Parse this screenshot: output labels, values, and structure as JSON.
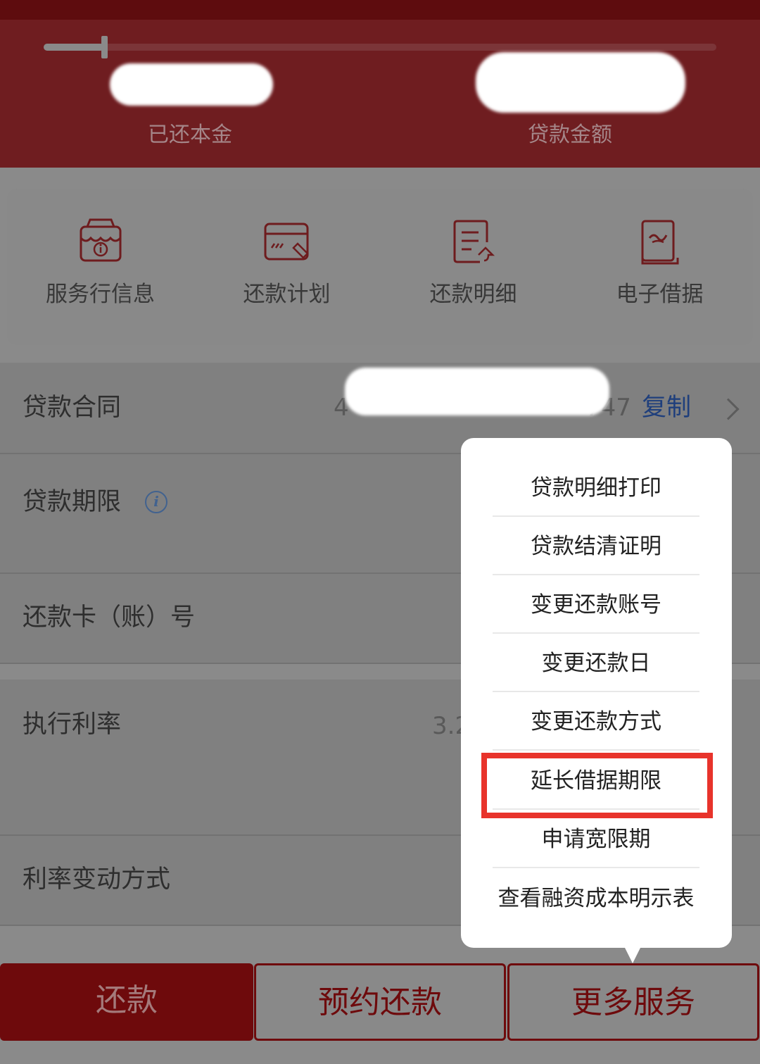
{
  "header": {
    "repaid_principal_label": "已还本金",
    "loan_amount_label": "贷款金额",
    "repaid_progress": 0.09
  },
  "quick_services": [
    {
      "label": "服务行信息",
      "icon": "bank-info-icon"
    },
    {
      "label": "还款计划",
      "icon": "repayment-plan-icon"
    },
    {
      "label": "还款明细",
      "icon": "repayment-detail-icon"
    },
    {
      "label": "电子借据",
      "icon": "e-receipt-icon"
    }
  ],
  "rows": {
    "contract": {
      "label": "贷款合同",
      "value_prefix": "4",
      "value_suffix": "747",
      "copy": "复制"
    },
    "term": {
      "label": "贷款期限",
      "info_icon": "info-icon"
    },
    "card": {
      "label": "还款卡（账）号"
    },
    "rate": {
      "label": "执行利率",
      "value": "3.2"
    },
    "rate_change": {
      "label": "利率变动方式"
    }
  },
  "menu": {
    "items": [
      "贷款明细打印",
      "贷款结清证明",
      "变更还款账号",
      "变更还款日",
      "变更还款方式",
      "延长借据期限",
      "申请宽限期",
      "查看融资成本明示表"
    ],
    "highlighted_index": 5
  },
  "bottom_bar": {
    "repay": "还款",
    "schedule_repay": "预约还款",
    "more_services": "更多服务"
  },
  "colors": {
    "brand_red": "#6e0a0c",
    "link_blue": "#1f3f7c",
    "highlight_red": "#e8332b"
  }
}
